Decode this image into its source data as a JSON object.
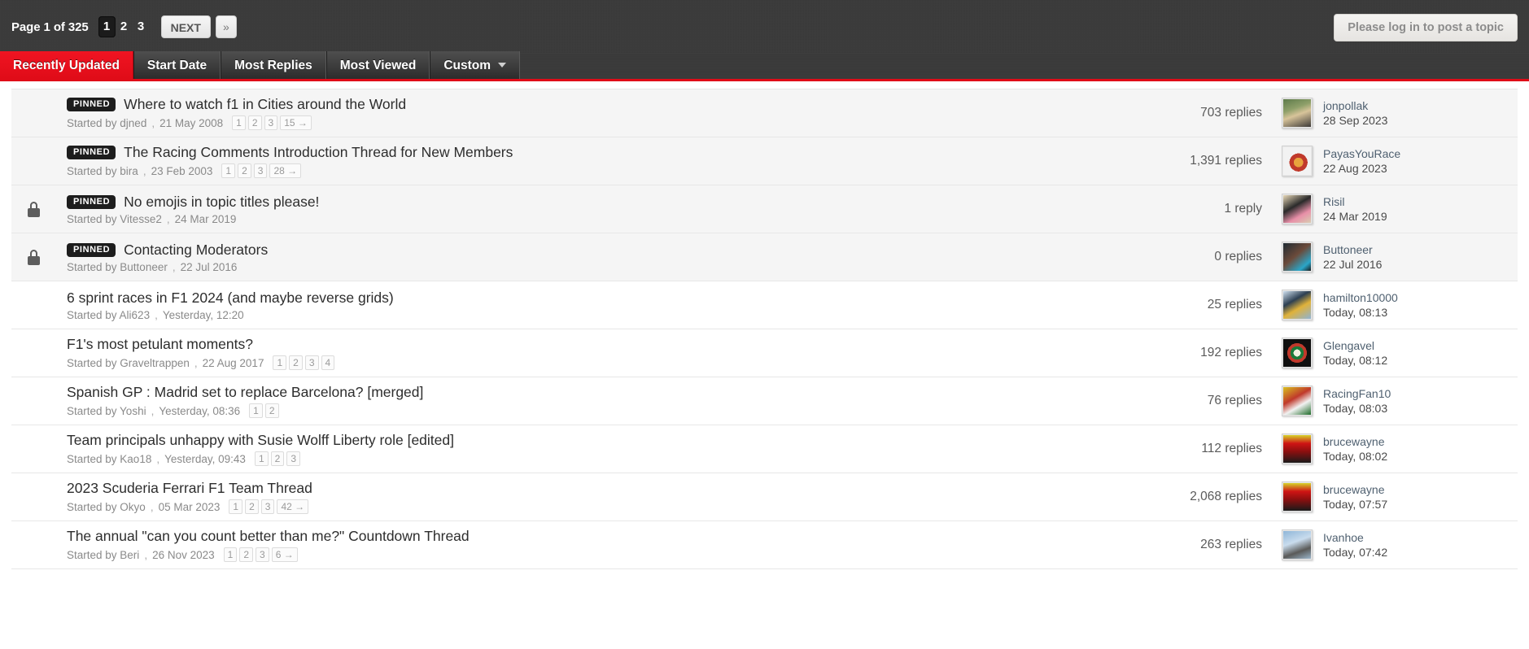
{
  "topbar": {
    "page_label_prefix": "Page",
    "page_label_current": "1",
    "page_label_of": "of",
    "page_label_total": "325",
    "page_label_full": "Page 1 of 325",
    "pages": [
      "1",
      "2",
      "3"
    ],
    "active_page": "1",
    "next_label": "NEXT",
    "last_label": "»",
    "post_topic_label": "Please log in to post a topic"
  },
  "tabs": [
    {
      "label": "Recently Updated",
      "active": true,
      "has_caret": false
    },
    {
      "label": "Start Date",
      "active": false,
      "has_caret": false
    },
    {
      "label": "Most Replies",
      "active": false,
      "has_caret": false
    },
    {
      "label": "Most Viewed",
      "active": false,
      "has_caret": false
    },
    {
      "label": "Custom",
      "active": false,
      "has_caret": true
    }
  ],
  "colors": {
    "accent_red": "#e00c18",
    "topbar_dark": "#3a3a3a",
    "pinned_row_bg": "#f5f5f5",
    "badge_black": "#1d1d1d"
  },
  "labels": {
    "started_by": "Started by",
    "comma": ","
  },
  "topics": [
    {
      "locked": false,
      "pinned": true,
      "pinned_label": "PINNED",
      "title": "Where to watch f1 in Cities around the World",
      "started_by": "Started by",
      "author": "djned",
      "date": "21 May 2008",
      "minipages": [
        "1",
        "2",
        "3"
      ],
      "jump": "15 →",
      "replies": "703 replies",
      "last_user": "jonpollak",
      "last_date": "28 Sep 2023",
      "avatar": "photo-woman-outdoors"
    },
    {
      "locked": false,
      "pinned": true,
      "pinned_label": "PINNED",
      "title": "The Racing Comments Introduction Thread for New Members",
      "started_by": "Started by",
      "author": "bira",
      "date": "23 Feb 2003",
      "minipages": [
        "1",
        "2",
        "3"
      ],
      "jump": "28 →",
      "replies": "1,391 replies",
      "last_user": "PayasYouRace",
      "last_date": "22 Aug 2023",
      "avatar": "cartoon-character-white-bg"
    },
    {
      "locked": true,
      "pinned": true,
      "pinned_label": "PINNED",
      "title": "No emojis in topic titles please!",
      "started_by": "Started by",
      "author": "Vitesse2",
      "date": "24 Mar 2019",
      "minipages": [],
      "jump": "",
      "replies": "1 reply",
      "last_user": "Risil",
      "last_date": "24 Mar 2019",
      "avatar": "cartoon-bird-pink-scarf"
    },
    {
      "locked": true,
      "pinned": true,
      "pinned_label": "PINNED",
      "title": "Contacting Moderators",
      "started_by": "Started by",
      "author": "Buttoneer",
      "date": "22 Jul 2016",
      "minipages": [],
      "jump": "",
      "replies": "0 replies",
      "last_user": "Buttoneer",
      "last_date": "22 Jul 2016",
      "avatar": "photo-man-shouting"
    },
    {
      "locked": false,
      "pinned": false,
      "pinned_label": "",
      "title": "6 sprint races in F1 2024 (and maybe reverse grids)",
      "started_by": "Started by",
      "author": "Ali623",
      "date": "Yesterday, 12:20",
      "minipages": [],
      "jump": "",
      "replies": "25 replies",
      "last_user": "hamilton10000",
      "last_date": "Today, 08:13",
      "avatar": "photo-helmet-blue"
    },
    {
      "locked": false,
      "pinned": false,
      "pinned_label": "",
      "title": "F1's most petulant moments?",
      "started_by": "Started by",
      "author": "Graveltrappen",
      "date": "22 Aug 2017",
      "minipages": [
        "1",
        "2",
        "3",
        "4"
      ],
      "jump": "",
      "replies": "192 replies",
      "last_user": "Glengavel",
      "last_date": "Today, 08:12",
      "avatar": "alfa-romeo-badge"
    },
    {
      "locked": false,
      "pinned": false,
      "pinned_label": "",
      "title": "Spanish GP : Madrid set to replace Barcelona? [merged]",
      "started_by": "Started by",
      "author": "Yoshi",
      "date": "Yesterday, 08:36",
      "minipages": [
        "1",
        "2"
      ],
      "jump": "",
      "replies": "76 replies",
      "last_user": "RacingFan10",
      "last_date": "Today, 08:03",
      "avatar": "photo-driver-red-suit"
    },
    {
      "locked": false,
      "pinned": false,
      "pinned_label": "",
      "title": "Team principals unhappy with Susie Wolff Liberty role [edited]",
      "started_by": "Started by",
      "author": "Kao18",
      "date": "Yesterday, 09:43",
      "minipages": [
        "1",
        "2",
        "3"
      ],
      "jump": "",
      "replies": "112 replies",
      "last_user": "brucewayne",
      "last_date": "Today, 08:02",
      "avatar": "ferrari-garage-red"
    },
    {
      "locked": false,
      "pinned": false,
      "pinned_label": "",
      "title": "2023 Scuderia Ferrari F1 Team Thread",
      "started_by": "Started by",
      "author": "Okyo",
      "date": "05 Mar 2023",
      "minipages": [
        "1",
        "2",
        "3"
      ],
      "jump": "42 →",
      "replies": "2,068 replies",
      "last_user": "brucewayne",
      "last_date": "Today, 07:57",
      "avatar": "ferrari-garage-red"
    },
    {
      "locked": false,
      "pinned": false,
      "pinned_label": "",
      "title": "The annual \"can you count better than me?\" Countdown Thread",
      "started_by": "Started by",
      "author": "Beri",
      "date": "26 Nov 2023",
      "minipages": [
        "1",
        "2",
        "3"
      ],
      "jump": "6 →",
      "replies": "263 replies",
      "last_user": "Ivanhoe",
      "last_date": "Today, 07:42",
      "avatar": "photo-bird-sky"
    }
  ]
}
